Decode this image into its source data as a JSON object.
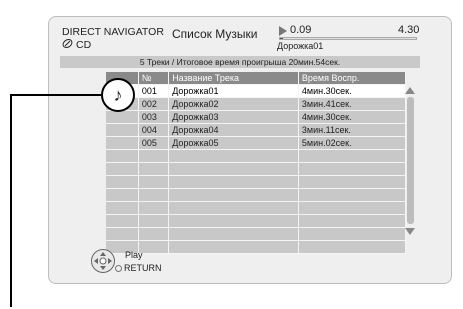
{
  "header": {
    "navigator_label": "DIRECT NAVIGATOR",
    "media_label": "CD",
    "title": "Список Музыки",
    "time_start": "0.09",
    "time_end": "4.30",
    "current_track": "Дорожка01",
    "progress_fraction": 0.02
  },
  "info": {
    "summary": "5 Треки / Итоговое время проигрыша 20мин.54сек."
  },
  "table": {
    "columns": [
      "№",
      "Название Трека",
      "Время Воспр."
    ],
    "rows": [
      {
        "num": "001",
        "name": "Дорожка01",
        "time": "4мин.30сек."
      },
      {
        "num": "002",
        "name": "Дорожка02",
        "time": "3мин.41сек."
      },
      {
        "num": "003",
        "name": "Дорожка03",
        "time": "4мин.30сек."
      },
      {
        "num": "004",
        "name": "Дорожка04",
        "time": "3мин.11сек."
      },
      {
        "num": "005",
        "name": "Дорожка05",
        "time": "5мин.02сек."
      }
    ],
    "selected_index": 0
  },
  "controls": {
    "play_label": "Play",
    "return_label": "RETURN"
  },
  "icons": {
    "media": "disc-icon",
    "selected_marker": "music-note-icon",
    "remote": "remote-dpad-icon"
  }
}
